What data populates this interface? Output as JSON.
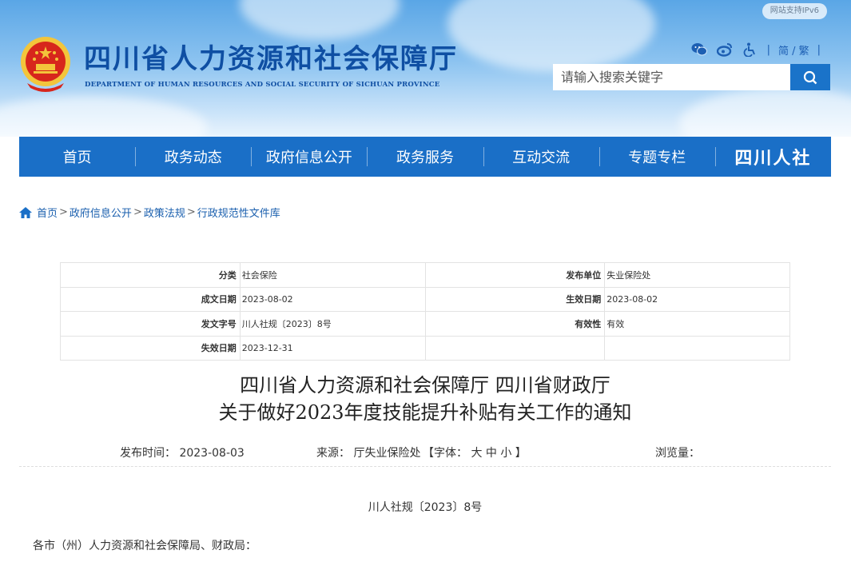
{
  "header": {
    "ipv6_badge": "网站支持IPv6",
    "title": "四川省人力资源和社会保障厅",
    "subtitle": "DEPARTMENT OF HUMAN RESOURCES AND SOCIAL SECURITY OF SICHUAN PROVINCE",
    "lang_toggle": "简 / 繁",
    "search_placeholder": "请输入搜索关键字"
  },
  "nav": {
    "items": [
      "首页",
      "政务动态",
      "政府信息公开",
      "政务服务",
      "互动交流",
      "专题专栏"
    ],
    "brand": "四川人社"
  },
  "breadcrumb": [
    "首页",
    "政府信息公开",
    "政策法规",
    "行政规范性文件库"
  ],
  "meta": {
    "rows": [
      [
        {
          "k": "分类",
          "v": "社会保险"
        },
        {
          "k": "发布单位",
          "v": "失业保险处"
        }
      ],
      [
        {
          "k": "成文日期",
          "v": "2023-08-02"
        },
        {
          "k": "生效日期",
          "v": "2023-08-02"
        }
      ],
      [
        {
          "k": "发文字号",
          "v": "川人社规〔2023〕8号"
        },
        {
          "k": "有效性",
          "v": "有效"
        }
      ],
      [
        {
          "k": "失效日期",
          "v": "2023-12-31"
        },
        {
          "k": "",
          "v": ""
        }
      ]
    ]
  },
  "document": {
    "title_line1": "四川省人力资源和社会保障厅  四川省财政厅",
    "title_line2": "关于做好2023年度技能提升补贴有关工作的通知",
    "publish_time": "发布时间： 2023-08-03",
    "source": "来源： 厅失业保险处",
    "font_size_control": "【字体： 大 中 小 】",
    "views": "浏览量：",
    "doc_number": "川人社规〔2023〕8号",
    "greeting": "各市（州）人力资源和社会保障局、财政局："
  },
  "colors": {
    "primary_blue": "#1a6fc7",
    "title_blue": "#0f4fa3",
    "emblem_red": "#d7261c",
    "emblem_gold": "#f3c53b"
  },
  "icons": [
    "national-emblem-icon",
    "wechat-icon",
    "weibo-icon",
    "accessibility-icon",
    "search-icon",
    "home-icon"
  ]
}
